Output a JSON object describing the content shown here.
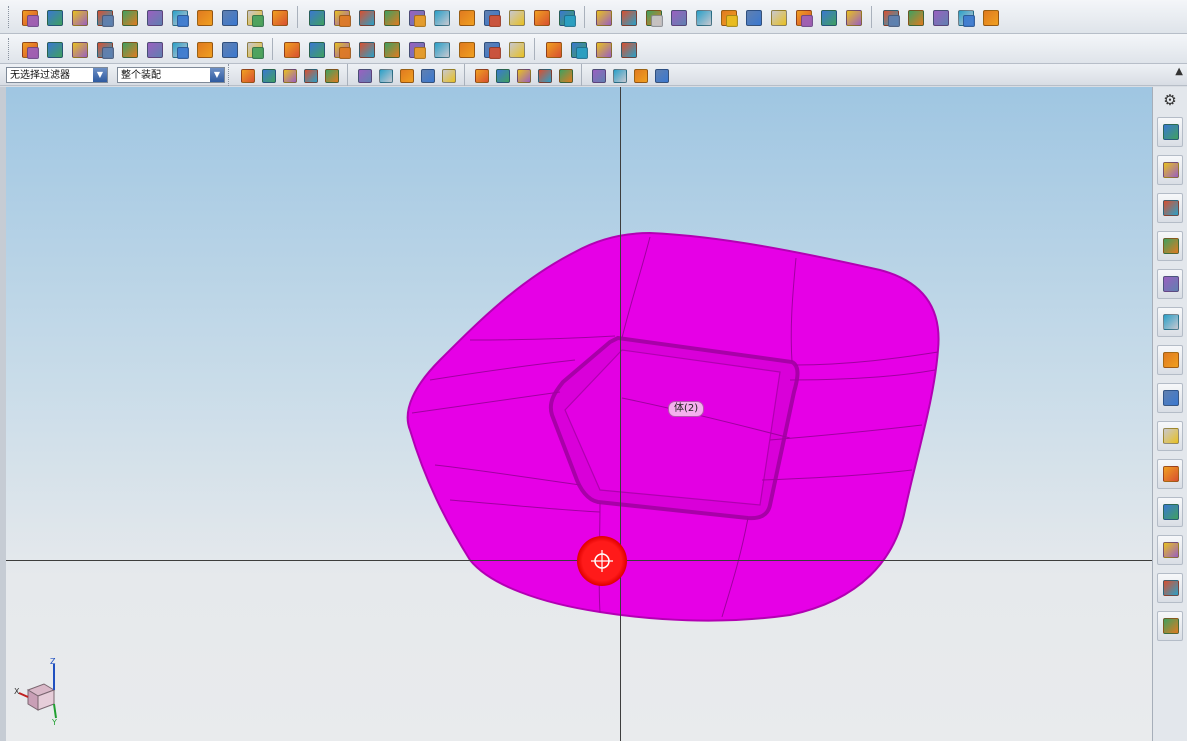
{
  "toolbar_filter": {
    "selected": "无选择过滤器",
    "arrow": "▼"
  },
  "toolbar_assembly": {
    "selected": "整个装配",
    "arrow": "▼"
  },
  "viewport": {
    "body_label": "体(2)",
    "triad": {
      "x": "X",
      "y": "Y",
      "z": "Z"
    }
  },
  "resource_bar": {
    "gear": "⚙"
  },
  "colors": {
    "body": "#e600e6",
    "body_edge": "#b300b3",
    "cursor": "#ff1a1a",
    "sky_top": "#9fc6e2",
    "floor": "#e9ebed"
  },
  "icons_row1": [
    "new-file-icon",
    "block-icon",
    "shield-icon",
    "cube-icon",
    "torus-icon",
    "sphere-icon",
    "plate-icon",
    "spring-icon",
    "chain-icon",
    "sew-icon",
    "fork-icon",
    "box-add-icon",
    "box-subtract-icon",
    "box-intersect-icon",
    "tube-icon",
    "cylinder-icon",
    "fold-icon",
    "blade-icon",
    "bracket-icon",
    "plane-icon",
    "wedge-icon",
    "split-body-icon",
    "solid-box-icon",
    "cone-icon",
    "shell-icon",
    "pyramid-icon",
    "cube-red-icon",
    "offset-icon",
    "measure-icon",
    "surface-a-icon",
    "surface-b-icon",
    "surface-c-icon",
    "surface-d-icon",
    "gear-sheet-icon",
    "diamond-icon",
    "tool-icon",
    "chain-link-icon",
    "ribbon-icon"
  ],
  "icons_row2": [
    "component-icon",
    "assembly-icon",
    "replace-icon",
    "mate-icon",
    "explode-icon",
    "array-icon",
    "sequence-icon",
    "link-icon",
    "wave-icon",
    "clearance-icon",
    "line-icon",
    "arc-icon",
    "spline-icon",
    "polygon-icon",
    "helix-icon",
    "offset-curve-icon",
    "project-curve-icon",
    "intersect-curve-icon",
    "curve-network-icon",
    "bridge-curve-icon",
    "trim-curve-icon",
    "extend-curve-icon",
    "divide-curve-icon",
    "fillet-curve-icon"
  ],
  "icons_row3": [
    "select-all-icon",
    "filter-body-icon",
    "snap-icon",
    "lasso-icon",
    "rect-select-icon",
    "wire-icon",
    "shade-icon",
    "point-snap-icon",
    "endpoint-icon",
    "midpoint-icon",
    "curve-snap-icon",
    "intersect-snap-icon",
    "center-icon",
    "circle-snap-icon",
    "cross-icon",
    "tangent-icon",
    "quadrant-icon",
    "layer-icon",
    "sphere-view-icon"
  ],
  "resource_tabs": [
    "assembly-navigator-icon",
    "constraint-navigator-icon",
    "part-navigator-icon",
    "reuse-library-icon",
    "web-browser-icon",
    "history-icon",
    "clock-icon",
    "visualization-icon",
    "role-icon",
    "process-icon",
    "analysis-icon",
    "template-icon",
    "report-icon",
    "system-icon"
  ]
}
